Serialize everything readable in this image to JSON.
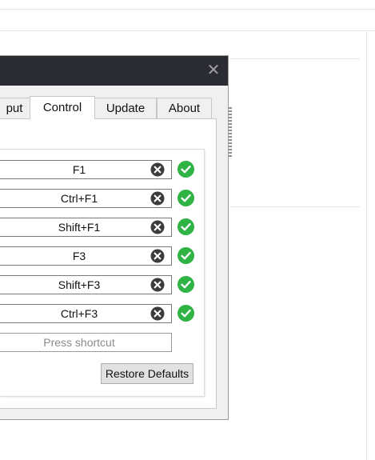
{
  "dialog": {
    "close_glyph": "✕",
    "tabs": [
      {
        "label": "put",
        "active": false
      },
      {
        "label": "Control",
        "active": true
      },
      {
        "label": "Update",
        "active": false
      },
      {
        "label": "About",
        "active": false
      }
    ],
    "shortcuts": [
      {
        "value": "F1",
        "valid": true
      },
      {
        "value": "Ctrl+F1",
        "valid": true
      },
      {
        "value": "Shift+F1",
        "valid": true
      },
      {
        "value": "F3",
        "valid": true
      },
      {
        "value": "Shift+F3",
        "valid": true
      },
      {
        "value": "Ctrl+F3",
        "valid": true
      }
    ],
    "new_shortcut_placeholder": "Press shortcut",
    "restore_defaults_label": "Restore Defaults",
    "colors": {
      "titlebar": "#2b2b32",
      "ok_green": "#2fb344",
      "clear_gray": "#3c3c3c"
    },
    "icons": {
      "clear": "clear-icon",
      "ok": "check-circle-icon",
      "close": "close-icon"
    }
  }
}
